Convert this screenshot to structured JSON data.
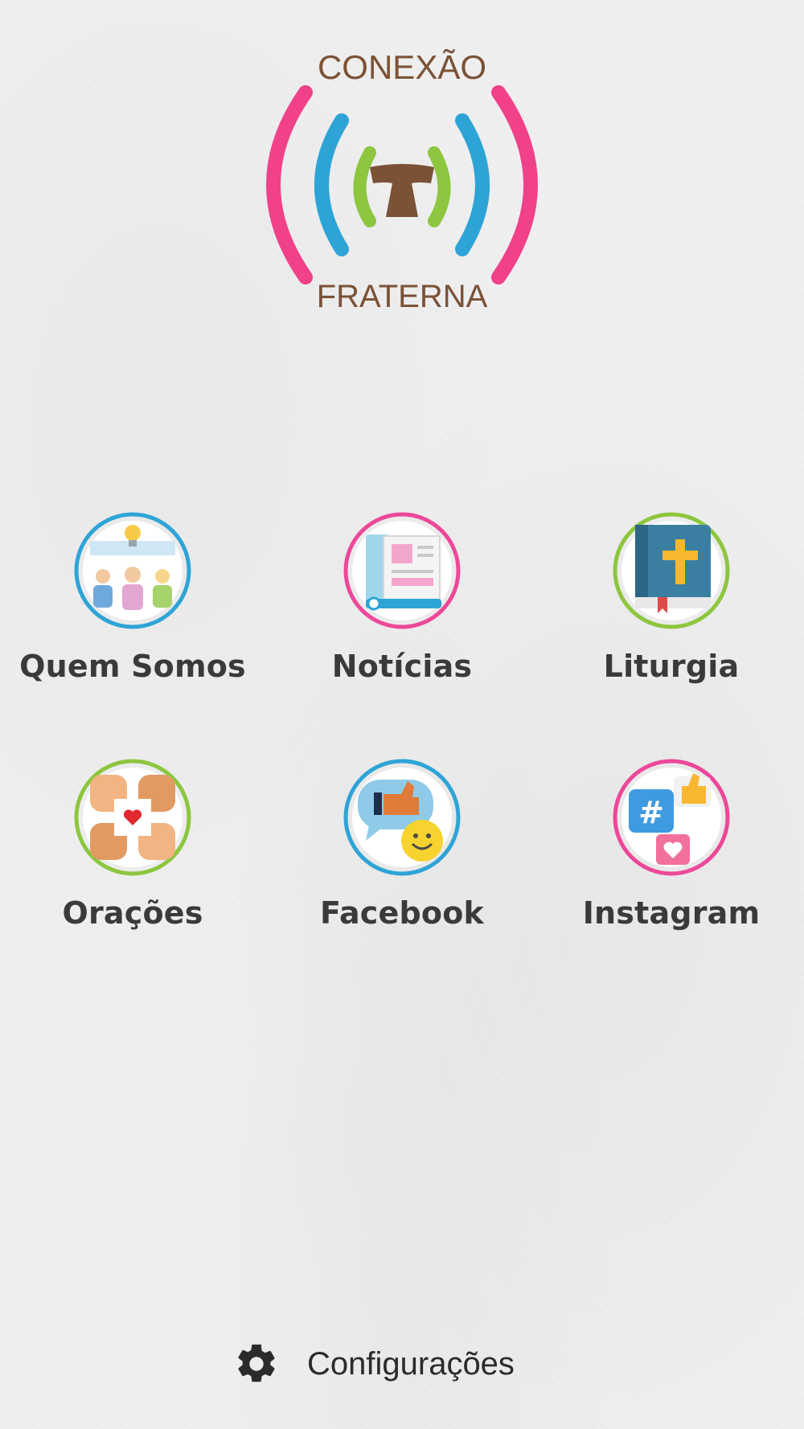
{
  "app": {
    "logo": {
      "line1": "CONEXÃO",
      "line2": "FRATERNA",
      "colors": {
        "pink": "#f0418a",
        "blue": "#2ea4d6",
        "green": "#8dc63f",
        "brown": "#7b5236"
      }
    }
  },
  "menu": {
    "items": [
      {
        "label": "Quem Somos",
        "icon": "people-idea-icon",
        "ring": "#2ea4d6"
      },
      {
        "label": "Notícias",
        "icon": "newspaper-icon",
        "ring": "#ec4899"
      },
      {
        "label": "Liturgia",
        "icon": "bible-icon",
        "ring": "#8dc63f"
      },
      {
        "label": "Orações",
        "icon": "joined-hands-heart-icon",
        "ring": "#8dc63f"
      },
      {
        "label": "Facebook",
        "icon": "like-chat-icon",
        "ring": "#2ea4d6"
      },
      {
        "label": "Instagram",
        "icon": "hashtag-social-icon",
        "ring": "#ec4899"
      }
    ]
  },
  "footer": {
    "settings_label": "Configurações",
    "settings_icon": "gear-icon"
  }
}
